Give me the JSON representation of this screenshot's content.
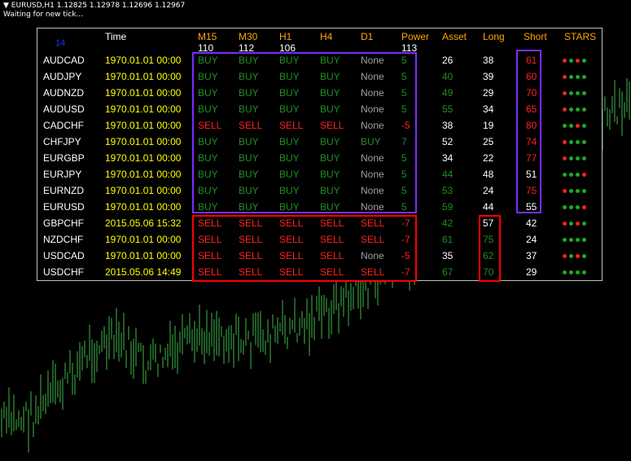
{
  "chart_header": {
    "symbol_line": "EURUSD,H1  1.12825 1.12978 1.12696 1.12967",
    "status_line": "Waiting for new tick..."
  },
  "panel": {
    "corner_value": "14",
    "headers": {
      "time": "Time",
      "m15": "M15",
      "m30": "M30",
      "h1": "H1",
      "h4": "H4",
      "d1": "D1",
      "power": "Power",
      "asset": "Asset",
      "long": "Long",
      "short": "Short",
      "stars": "STARS"
    },
    "subheaders": {
      "m15": "110",
      "m30": "112",
      "h1": "106",
      "power": "113"
    },
    "rows": [
      {
        "pair": "AUDCAD",
        "time": "1970.01.01 00:00",
        "m15": "BUY",
        "m30": "BUY",
        "h1": "BUY",
        "h4": "BUY",
        "d1": "None",
        "power": "5",
        "asset": "26",
        "long": "38",
        "short": "61",
        "stars": [
          "red",
          "green",
          "red",
          "green"
        ]
      },
      {
        "pair": "AUDJPY",
        "time": "1970.01.01 00:00",
        "m15": "BUY",
        "m30": "BUY",
        "h1": "BUY",
        "h4": "BUY",
        "d1": "None",
        "power": "5",
        "asset": "40",
        "long": "39",
        "short": "60",
        "stars": [
          "red",
          "green",
          "green",
          "green"
        ]
      },
      {
        "pair": "AUDNZD",
        "time": "1970.01.01 00:00",
        "m15": "BUY",
        "m30": "BUY",
        "h1": "BUY",
        "h4": "BUY",
        "d1": "None",
        "power": "5",
        "asset": "49",
        "long": "29",
        "short": "70",
        "stars": [
          "red",
          "green",
          "green",
          "green"
        ]
      },
      {
        "pair": "AUDUSD",
        "time": "1970.01.01 00:00",
        "m15": "BUY",
        "m30": "BUY",
        "h1": "BUY",
        "h4": "BUY",
        "d1": "None",
        "power": "5",
        "asset": "55",
        "long": "34",
        "short": "65",
        "stars": [
          "red",
          "green",
          "green",
          "green"
        ]
      },
      {
        "pair": "CADCHF",
        "time": "1970.01.01 00:00",
        "m15": "SELL",
        "m30": "SELL",
        "h1": "SELL",
        "h4": "SELL",
        "d1": "None",
        "power": "-5",
        "asset": "38",
        "long": "19",
        "short": "80",
        "stars": [
          "green",
          "green",
          "red",
          "green"
        ]
      },
      {
        "pair": "CHFJPY",
        "time": "1970.01.01 00:00",
        "m15": "BUY",
        "m30": "BUY",
        "h1": "BUY",
        "h4": "BUY",
        "d1": "BUY",
        "power": "7",
        "asset": "52",
        "long": "25",
        "short": "74",
        "stars": [
          "red",
          "green",
          "green",
          "green"
        ]
      },
      {
        "pair": "EURGBP",
        "time": "1970.01.01 00:00",
        "m15": "BUY",
        "m30": "BUY",
        "h1": "BUY",
        "h4": "BUY",
        "d1": "None",
        "power": "5",
        "asset": "34",
        "long": "22",
        "short": "77",
        "stars": [
          "red",
          "green",
          "green",
          "green"
        ]
      },
      {
        "pair": "EURJPY",
        "time": "1970.01.01 00:00",
        "m15": "BUY",
        "m30": "BUY",
        "h1": "BUY",
        "h4": "BUY",
        "d1": "None",
        "power": "5",
        "asset": "44",
        "long": "48",
        "short": "51",
        "stars": [
          "green",
          "green",
          "green",
          "red"
        ]
      },
      {
        "pair": "EURNZD",
        "time": "1970.01.01 00:00",
        "m15": "BUY",
        "m30": "BUY",
        "h1": "BUY",
        "h4": "BUY",
        "d1": "None",
        "power": "5",
        "asset": "53",
        "long": "24",
        "short": "75",
        "stars": [
          "red",
          "green",
          "green",
          "green"
        ]
      },
      {
        "pair": "EURUSD",
        "time": "1970.01.01 00:00",
        "m15": "BUY",
        "m30": "BUY",
        "h1": "BUY",
        "h4": "BUY",
        "d1": "None",
        "power": "5",
        "asset": "59",
        "long": "44",
        "short": "55",
        "stars": [
          "green",
          "green",
          "green",
          "red"
        ]
      },
      {
        "pair": "GBPCHF",
        "time": "2015.05.06 15:32",
        "m15": "SELL",
        "m30": "SELL",
        "h1": "SELL",
        "h4": "SELL",
        "d1": "SELL",
        "power": "-7",
        "asset": "42",
        "long": "57",
        "short": "42",
        "stars": [
          "red",
          "green",
          "red",
          "green"
        ]
      },
      {
        "pair": "NZDCHF",
        "time": "1970.01.01 00:00",
        "m15": "SELL",
        "m30": "SELL",
        "h1": "SELL",
        "h4": "SELL",
        "d1": "SELL",
        "power": "-7",
        "asset": "61",
        "long": "75",
        "short": "24",
        "stars": [
          "green",
          "green",
          "green",
          "green"
        ]
      },
      {
        "pair": "USDCAD",
        "time": "1970.01.01 00:00",
        "m15": "SELL",
        "m30": "SELL",
        "h1": "SELL",
        "h4": "SELL",
        "d1": "None",
        "power": "-5",
        "asset": "35",
        "long": "62",
        "short": "37",
        "stars": [
          "red",
          "green",
          "red",
          "green"
        ]
      },
      {
        "pair": "USDCHF",
        "time": "2015.05.06 14:49",
        "m15": "SELL",
        "m30": "SELL",
        "h1": "SELL",
        "h4": "SELL",
        "d1": "SELL",
        "power": "-7",
        "asset": "67",
        "long": "70",
        "short": "29",
        "stars": [
          "green",
          "green",
          "green",
          "green"
        ]
      }
    ],
    "cell_colors": {
      "asset": [
        "white",
        "green",
        "green",
        "green",
        "white",
        "white",
        "white",
        "green",
        "green",
        "green",
        "green",
        "green",
        "white",
        "green"
      ],
      "long": [
        "white",
        "white",
        "white",
        "white",
        "white",
        "white",
        "white",
        "white",
        "white",
        "white",
        "white",
        "green",
        "green",
        "green"
      ],
      "short": [
        "red",
        "red",
        "red",
        "red",
        "red",
        "red",
        "red",
        "white",
        "red",
        "white",
        "white",
        "white",
        "white",
        "white"
      ]
    },
    "colors": {
      "buy": "#1f8f1f",
      "sell": "#ff2020",
      "none": "#a0a0a0",
      "header": "#ffa500",
      "time": "#ffff00",
      "buy_box": "#7b2cff",
      "sell_box": "#ff0000",
      "candle": "#3fb84a",
      "star_red": "#ff2020",
      "star_green": "#1faa1f"
    }
  }
}
